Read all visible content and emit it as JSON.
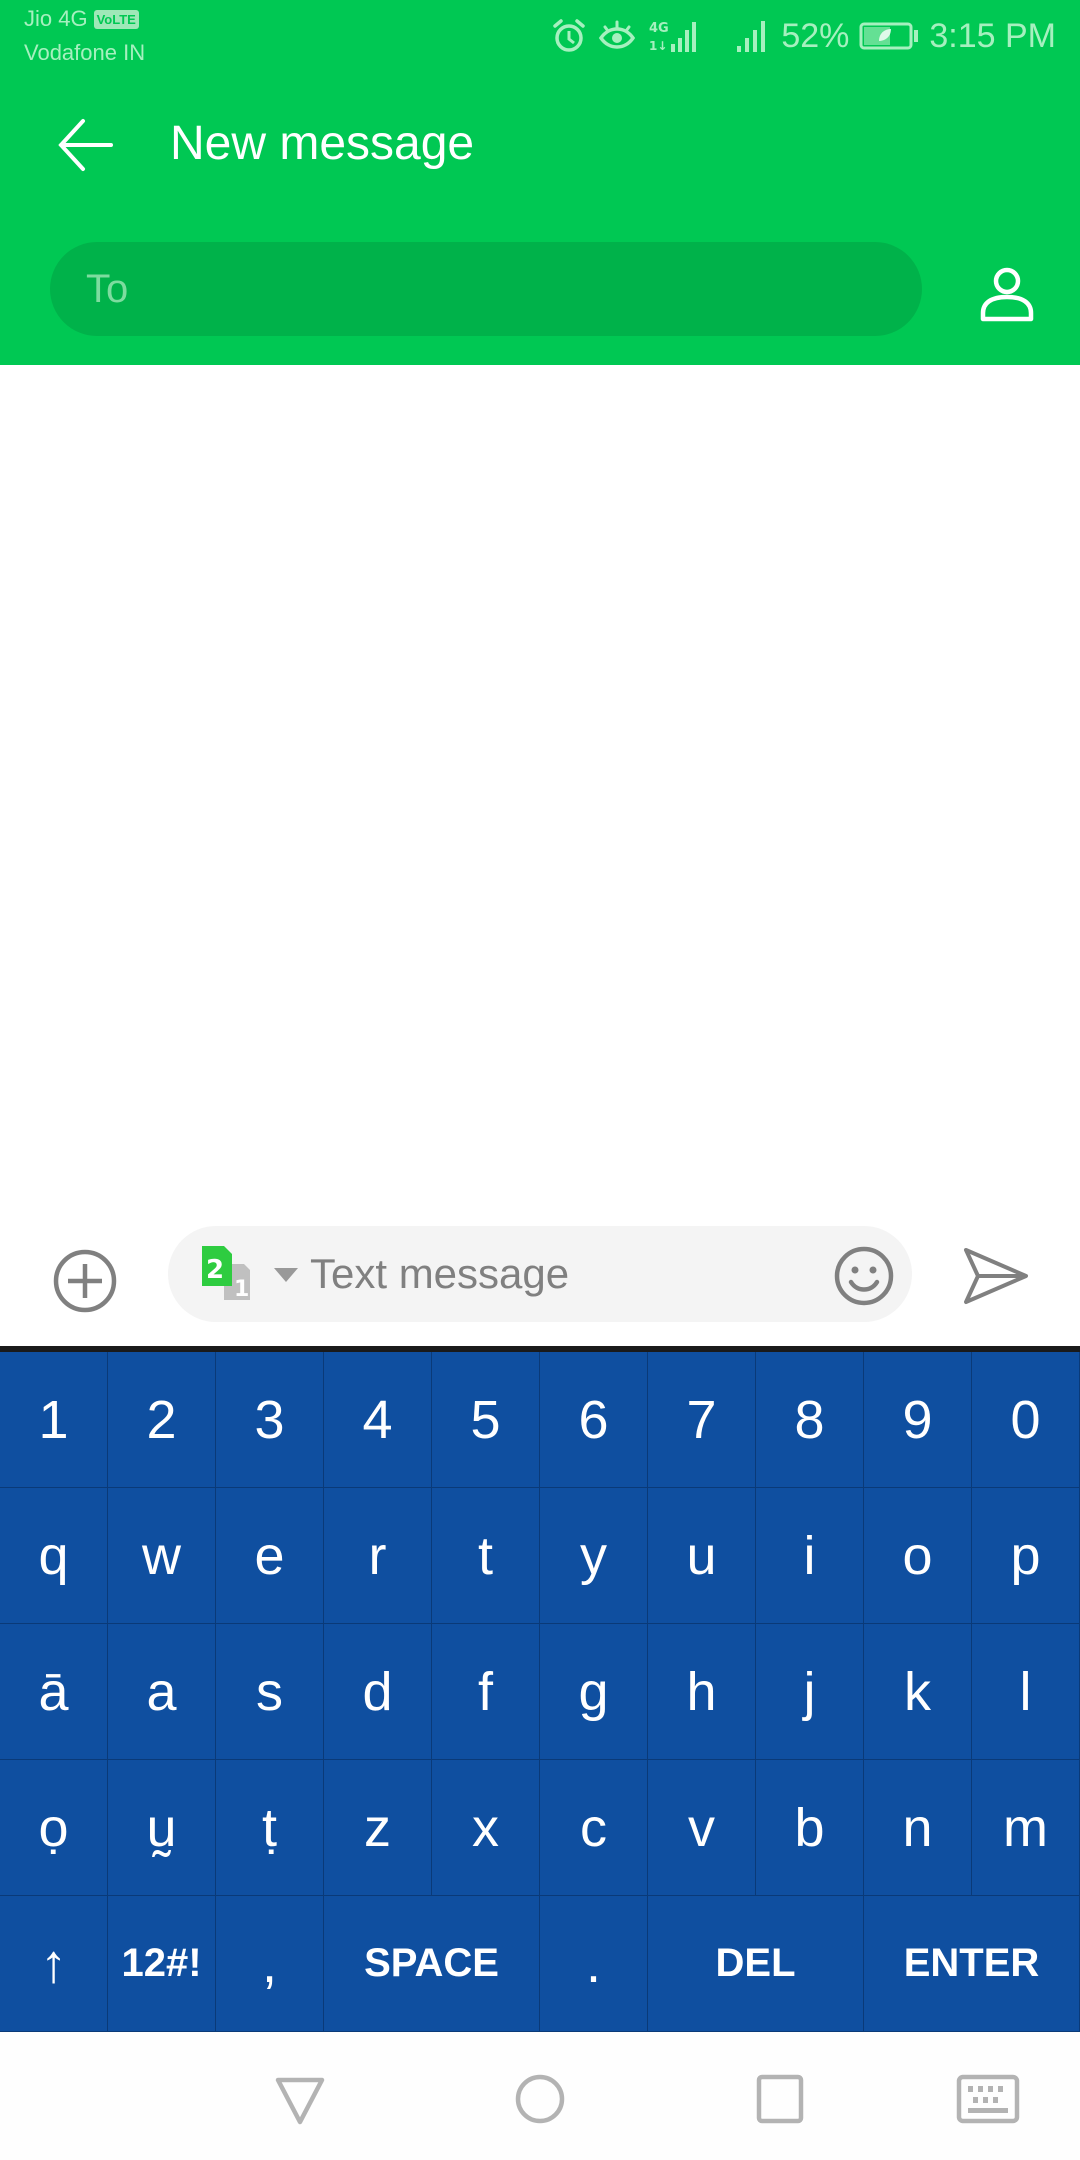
{
  "status_bar": {
    "carrier_1": "Jio 4G",
    "carrier_1_badge": "VoLTE",
    "carrier_2": "Vodafone IN",
    "network_type": "4G",
    "battery_percent": "52%",
    "time": "3:15 PM",
    "icons": [
      "alarm-icon",
      "eye-comfort-icon",
      "signal-4g-icon",
      "signal-icon",
      "battery-saver-icon"
    ]
  },
  "toolbar": {
    "title": "New message",
    "back_icon": "arrow-left-icon",
    "contact_icon": "person-icon"
  },
  "recipient": {
    "placeholder": "To",
    "value": ""
  },
  "compose": {
    "placeholder": "Text message",
    "value": "",
    "sim_front": "2",
    "sim_back": "1",
    "add_icon": "plus-circle-icon",
    "emoji_icon": "smiley-icon",
    "send_icon": "send-icon"
  },
  "keyboard": {
    "rows": [
      [
        "1",
        "2",
        "3",
        "4",
        "5",
        "6",
        "7",
        "8",
        "9",
        "0"
      ],
      [
        "q",
        "w",
        "e",
        "r",
        "t",
        "y",
        "u",
        "i",
        "o",
        "p"
      ],
      [
        "ā",
        "a",
        "s",
        "d",
        "f",
        "g",
        "h",
        "j",
        "k",
        "l"
      ],
      [
        "ọ",
        "ṵ",
        "ṭ",
        "z",
        "x",
        "c",
        "v",
        "b",
        "n",
        "m"
      ],
      [
        "↑",
        "12#!",
        ",",
        "SPACE",
        ".",
        "DEL",
        "ENTER"
      ]
    ]
  },
  "nav_bar": {
    "buttons": [
      "back-triangle-icon",
      "home-circle-icon",
      "recents-square-icon",
      "keyboard-icon"
    ]
  },
  "colors": {
    "header_green": "#00c853",
    "field_green": "#00b24a",
    "keyboard_blue": "#0f4fa0",
    "sim_green": "#2ecc40"
  }
}
